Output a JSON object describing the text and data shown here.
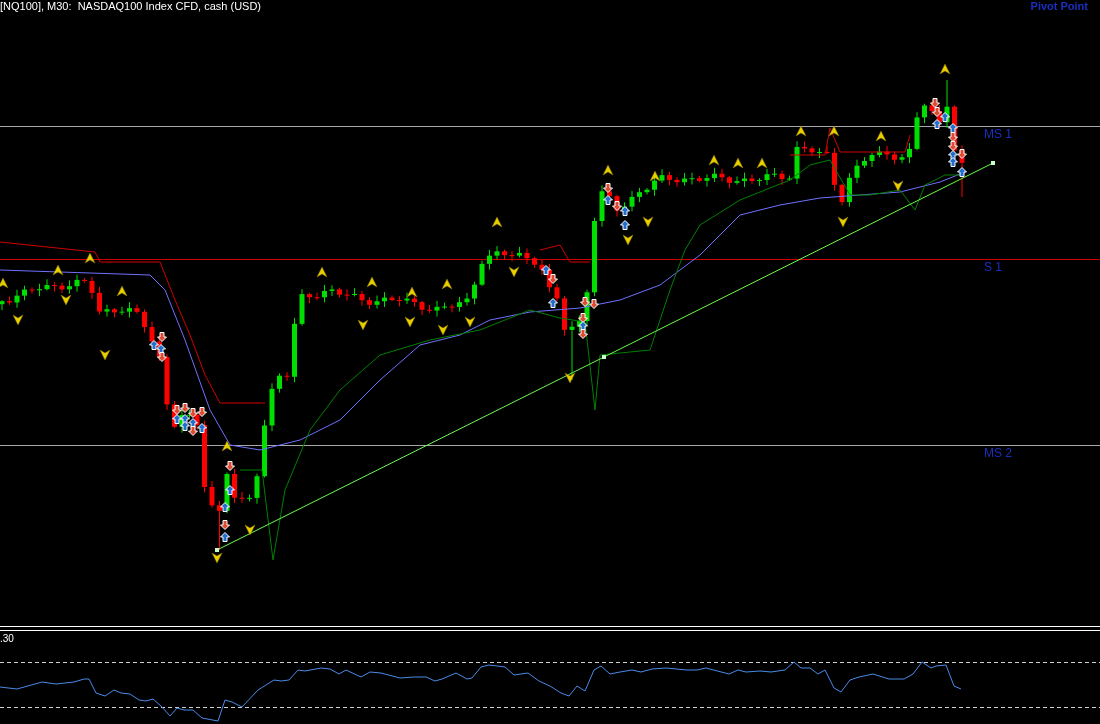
{
  "chart": {
    "title": "[NQ100], M30:  NASDAQ100 Index CFD, cash (USD)",
    "indicator_label": "Pivot Point",
    "levels": [
      {
        "label": "MS 1",
        "color": "#a8a8a8"
      },
      {
        "label": "S 1",
        "color": "#d00000"
      },
      {
        "label": "MS 2",
        "color": "#a8a8a8"
      }
    ]
  },
  "indicator_window": {
    "value_label": ".30"
  }
}
